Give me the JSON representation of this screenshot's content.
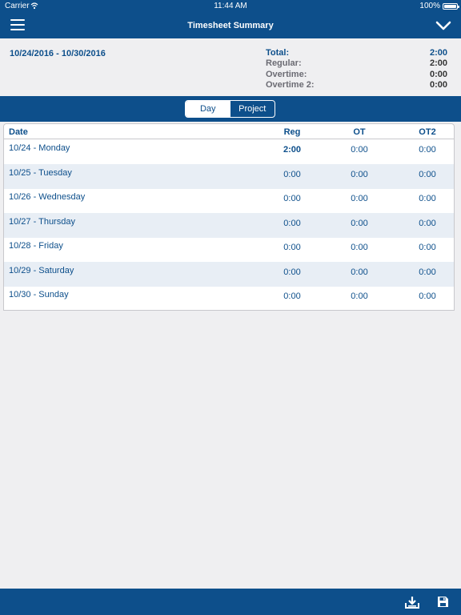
{
  "status_bar": {
    "carrier": "Carrier",
    "time": "11:44 AM",
    "battery": "100%"
  },
  "header": {
    "title": "Timesheet Summary"
  },
  "summary": {
    "date_range": "10/24/2016 - 10/30/2016",
    "rows": [
      {
        "label": "Total:",
        "value": "2:00"
      },
      {
        "label": "Regular:",
        "value": "2:00"
      },
      {
        "label": "Overtime:",
        "value": "0:00"
      },
      {
        "label": "Overtime 2:",
        "value": "0:00"
      }
    ]
  },
  "segments": [
    "Day",
    "Project"
  ],
  "table": {
    "headers": [
      "Date",
      "Reg",
      "OT",
      "OT2"
    ],
    "rows": [
      {
        "date": "10/24 - Monday",
        "reg": "2:00",
        "ot": "0:00",
        "ot2": "0:00"
      },
      {
        "date": "10/25 - Tuesday",
        "reg": "0:00",
        "ot": "0:00",
        "ot2": "0:00"
      },
      {
        "date": "10/26 - Wednesday",
        "reg": "0:00",
        "ot": "0:00",
        "ot2": "0:00"
      },
      {
        "date": "10/27 - Thursday",
        "reg": "0:00",
        "ot": "0:00",
        "ot2": "0:00"
      },
      {
        "date": "10/28 - Friday",
        "reg": "0:00",
        "ot": "0:00",
        "ot2": "0:00"
      },
      {
        "date": "10/29 - Saturday",
        "reg": "0:00",
        "ot": "0:00",
        "ot2": "0:00"
      },
      {
        "date": "10/30 - Sunday",
        "reg": "0:00",
        "ot": "0:00",
        "ot2": "0:00"
      }
    ]
  },
  "icons": {
    "menu": "hamburger-icon",
    "expand": "chevron-down-icon",
    "download": "download-icon",
    "save": "save-icon"
  },
  "colors": {
    "primary": "#0d4f8b",
    "row_alt": "#e8eef5",
    "background": "#efeff1"
  }
}
